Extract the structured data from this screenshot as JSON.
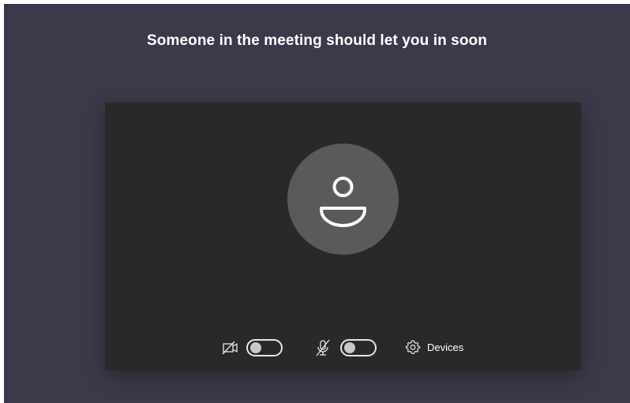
{
  "header": {
    "title": "Someone in the meeting should let you in soon"
  },
  "preview": {
    "avatar_icon": "person-icon"
  },
  "controls": {
    "camera": {
      "icon": "camera-off-icon",
      "state": "off"
    },
    "microphone": {
      "icon": "microphone-off-icon",
      "state": "off"
    },
    "devices": {
      "icon": "gear-icon",
      "label": "Devices"
    }
  },
  "colors": {
    "window_background": "#3b3a4a",
    "preview_background": "#292929",
    "avatar_background": "#5a5a5a",
    "text": "#ffffff"
  }
}
